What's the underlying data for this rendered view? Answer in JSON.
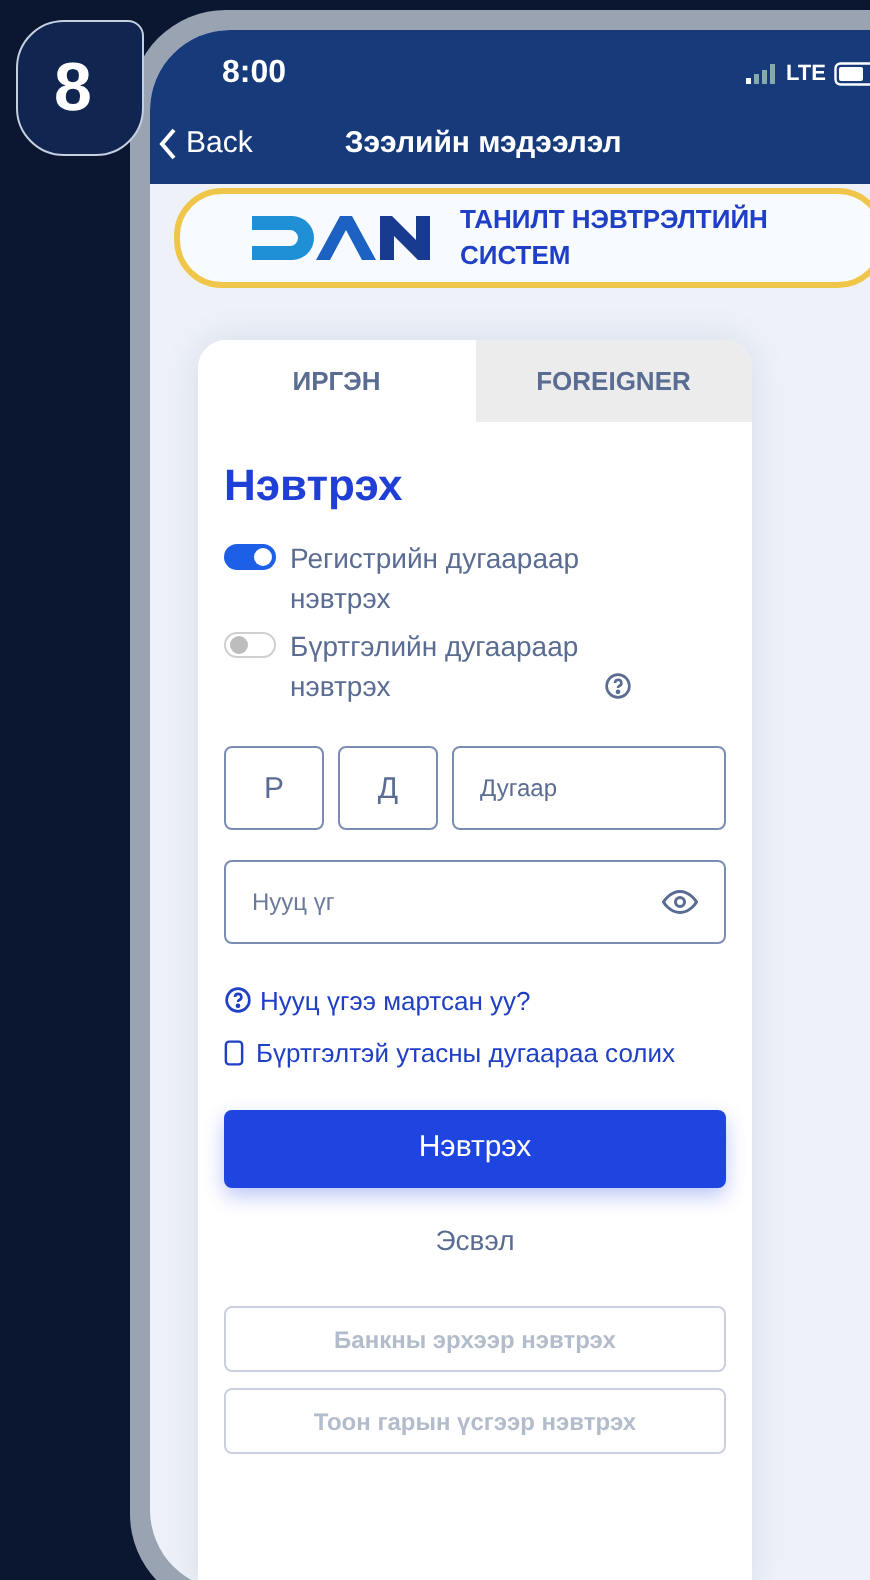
{
  "step_badge": "8",
  "status_bar": {
    "time": "8:00",
    "network": "LTE"
  },
  "nav": {
    "back": "Back",
    "title": "Зээлийн мэдээлэл"
  },
  "banner": {
    "title": "ТАНИЛТ НЭВТРЭЛТИЙН СИСТЕМ"
  },
  "tabs": [
    {
      "label": "ИРГЭН",
      "selected": true
    },
    {
      "label": "FOREIGNER",
      "selected": false
    }
  ],
  "heading": "Нэвтрэх",
  "toggles": [
    {
      "label": "Регистрийн дугаараар нэвтрэх",
      "on": true,
      "help": false
    },
    {
      "label": "Бүртгэлийн дугаараар нэвтрэх",
      "on": false,
      "help": true
    }
  ],
  "register_fields": [
    {
      "placeholder": "Р",
      "kind": "letter"
    },
    {
      "placeholder": "Д",
      "kind": "letter"
    },
    {
      "placeholder": "Дугаар",
      "kind": "number"
    }
  ],
  "password": {
    "placeholder": "Нууц үг"
  },
  "links": [
    {
      "kind": "help",
      "label": "Нууц үгээ мартсан уу?"
    },
    {
      "kind": "phone",
      "label": "Бүртгэлтэй утасны дугаараа солих"
    }
  ],
  "submit": "Нэвтрэх",
  "divider": "Эсвэл",
  "alt_buttons": [
    {
      "label": "Банкны эрхээр нэвтрэх",
      "disabled": true
    },
    {
      "label": "Тоон гарын үсгээр нэвтрэх",
      "disabled": true
    }
  ]
}
